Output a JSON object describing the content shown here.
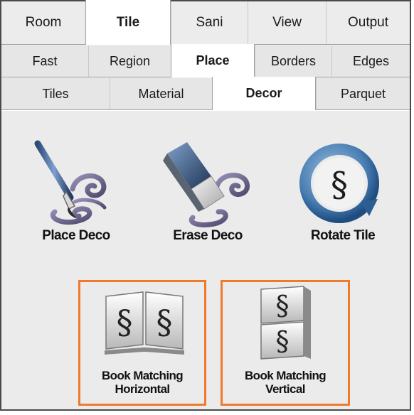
{
  "tabs_main": [
    {
      "label": "Room",
      "active": false
    },
    {
      "label": "Tile",
      "active": true
    },
    {
      "label": "Sani",
      "active": false
    },
    {
      "label": "View",
      "active": false
    },
    {
      "label": "Output",
      "active": false
    }
  ],
  "tabs_sub": [
    {
      "label": "Fast",
      "active": false
    },
    {
      "label": "Region",
      "active": false
    },
    {
      "label": "Place",
      "active": true
    },
    {
      "label": "Borders",
      "active": false
    },
    {
      "label": "Edges",
      "active": false
    }
  ],
  "tabs_sub2": [
    {
      "label": "Tiles",
      "active": false
    },
    {
      "label": "Material",
      "active": false
    },
    {
      "label": "Decor",
      "active": true
    },
    {
      "label": "Parquet",
      "active": false
    }
  ],
  "tools": [
    {
      "label": "Place Deco",
      "icon": "brush-swirl-icon"
    },
    {
      "label": "Erase Deco",
      "icon": "eraser-swirl-icon"
    },
    {
      "label": "Rotate Tile",
      "icon": "rotate-tile-icon"
    }
  ],
  "book_tools": [
    {
      "line1": "Book Matching",
      "line2": "Horizontal",
      "icon": "book-horizontal-icon"
    },
    {
      "line1": "Book Matching",
      "line2": "Vertical",
      "icon": "book-vertical-icon"
    }
  ],
  "colors": {
    "highlight": "#f07a2a",
    "panel_bg": "#ebebeb",
    "active_tab": "#ffffff"
  }
}
